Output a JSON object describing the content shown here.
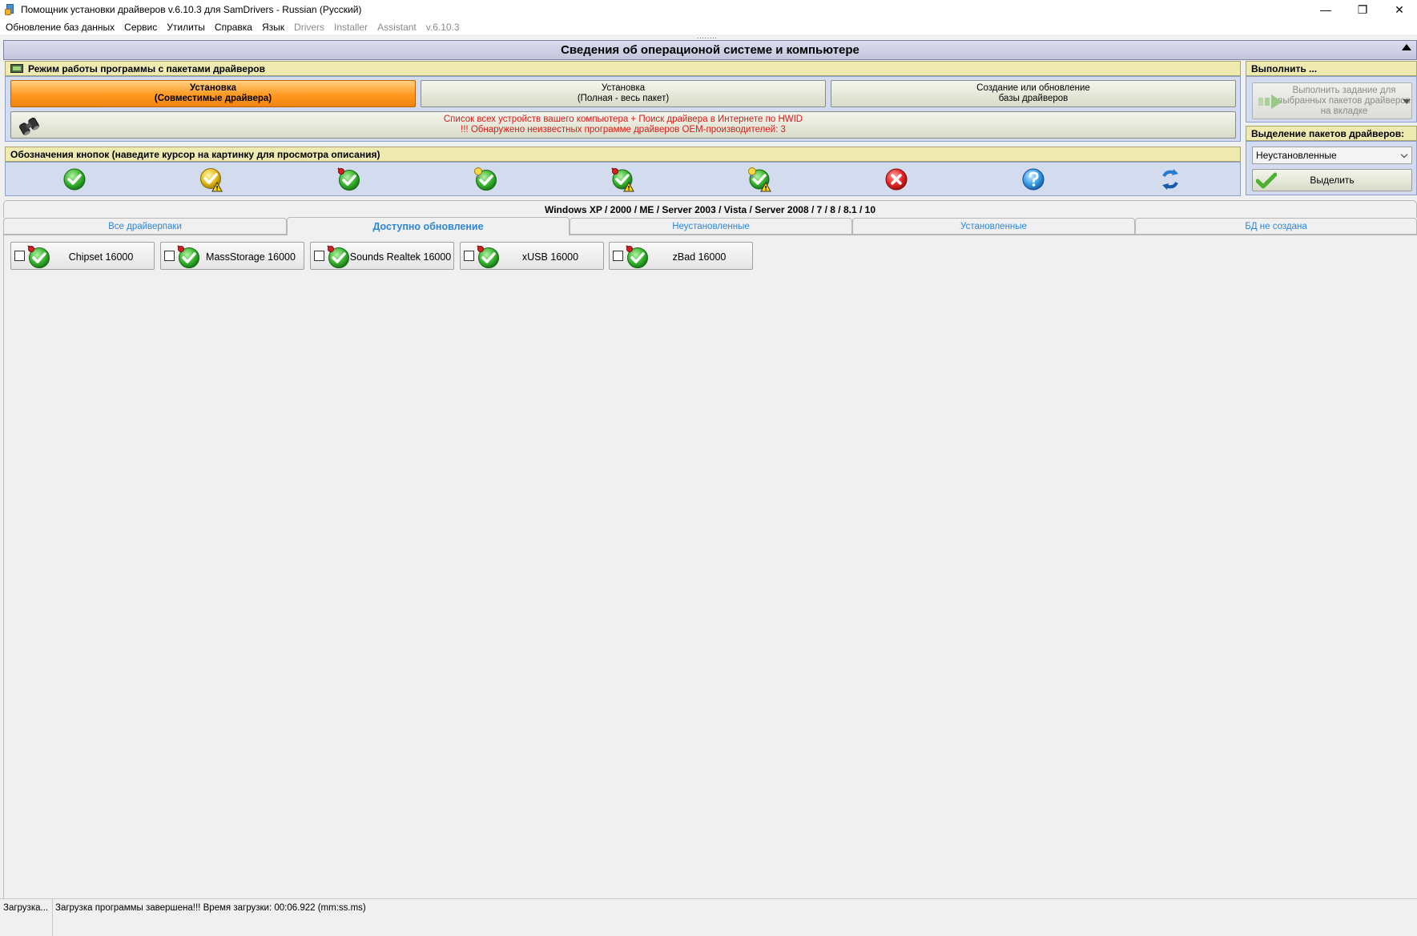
{
  "window": {
    "title": "Помощник установки драйверов v.6.10.3 для SamDrivers - Russian (Русский)",
    "min_glyph": "—",
    "max_glyph": "❐",
    "close_glyph": "✕"
  },
  "menu": {
    "items": [
      {
        "label": "Обновление баз данных",
        "enabled": true
      },
      {
        "label": "Сервис",
        "enabled": true
      },
      {
        "label": "Утилиты",
        "enabled": true
      },
      {
        "label": "Справка",
        "enabled": true
      },
      {
        "label": "Язык",
        "enabled": true
      },
      {
        "label": "Drivers",
        "enabled": false
      },
      {
        "label": "Installer",
        "enabled": false
      },
      {
        "label": "Assistant",
        "enabled": false
      },
      {
        "label": "v.6.10.3",
        "enabled": false
      }
    ]
  },
  "splitter": "........",
  "header": {
    "title": "Сведения об операционой системе и компьютере"
  },
  "mode_panel": {
    "title": "Режим работы программы с пакетами драйверов",
    "buttons": [
      {
        "line1": "Установка",
        "line2": "(Совместимые драйвера)",
        "active": true
      },
      {
        "line1": "Установка",
        "line2": "(Полная - весь пакет)",
        "active": false
      },
      {
        "line1": "Создание или обновление",
        "line2": "базы драйверов",
        "active": false
      }
    ],
    "device_list": {
      "line1": "Список всех устройств вашего компьютера + Поиск драйвера в Интернете по HWID",
      "line2": "!!! Обнаружено неизвестных программе драйверов OEM-производителей: 3"
    }
  },
  "legend_panel": {
    "title": "Обозначения кнопок (наведите курсор на картинку для просмотра описания)",
    "icons": [
      "green-check-icon",
      "yellow-check-warning-icon",
      "green-check-pin-icon",
      "green-check-bulb-icon",
      "green-check-pin-warning-icon",
      "green-check-bulb-warning-icon",
      "red-cross-icon",
      "blue-question-icon",
      "blue-refresh-arrows-icon"
    ]
  },
  "right_panel": {
    "execute_title": "Выполнить ...",
    "execute_button": "Выполнить задание для выбранных пакетов драйверов на вкладке",
    "select_title": "Выделение пакетов драйверов:",
    "select_value": "Неустановленные",
    "select_button": "Выделить"
  },
  "os_line": "Windows XP / 2000 / ME / Server 2003 / Vista / Server 2008 / 7 / 8 / 8.1 / 10",
  "tabs": [
    {
      "label": "Все драйверпаки",
      "active": false
    },
    {
      "label": "Доступно обновление",
      "active": true
    },
    {
      "label": "Неустановленные",
      "active": false
    },
    {
      "label": "Установленные",
      "active": false
    },
    {
      "label": "БД не создана",
      "active": false
    }
  ],
  "packages": [
    {
      "label": "Chipset 16000",
      "checked": false
    },
    {
      "label": "MassStorage 16000",
      "checked": false
    },
    {
      "label": "Sounds Realtek 16000",
      "checked": false
    },
    {
      "label": "xUSB 16000",
      "checked": false
    },
    {
      "label": "zBad 16000",
      "checked": false
    }
  ],
  "status": {
    "left": "Загрузка...",
    "message": "Загрузка программы завершена!!! Время загрузки: 00:06.922 (mm:ss.ms)"
  },
  "colors": {
    "accent_orange": "#ff9820",
    "panel_header": "#eeeab0",
    "panel_body": "#d2dcee",
    "tab_text": "#2f86d8",
    "alert_red": "#e01818"
  }
}
